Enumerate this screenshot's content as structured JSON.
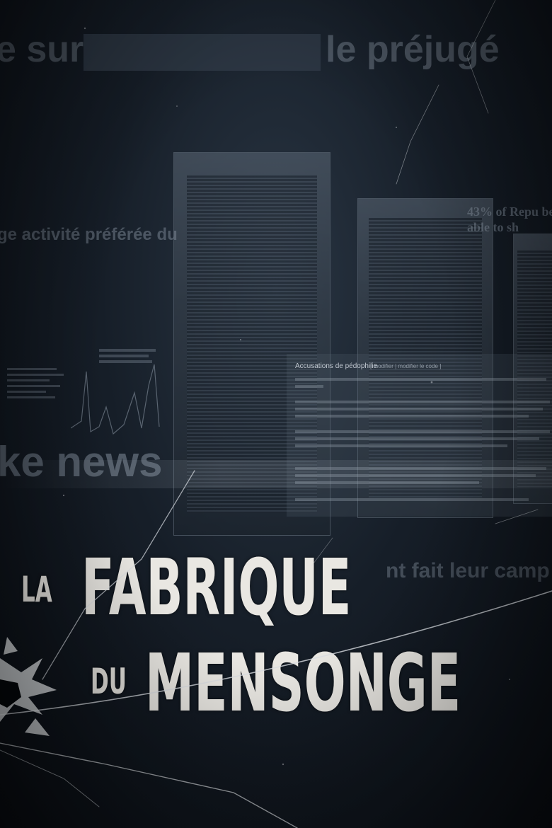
{
  "background_text": {
    "line_1_left": "e sur",
    "line_1_right": "le préjugé",
    "line_2": "ge activité préférée du",
    "line_3": "43% of Repu be able to sh",
    "line_4": "ke news",
    "line_5": "nt fait leur camp"
  },
  "document": {
    "heading": "Accusations de pédophilie",
    "edit_links": "[ modifier | modifier le code ]"
  },
  "title": {
    "article_1": "LA",
    "word_1": "FABRIQUE",
    "article_2": "DU",
    "word_2": "MENSONGE"
  },
  "colors": {
    "title": "#e9e7e2",
    "background": "#0b1016",
    "overlay_text": "#8a96a4"
  }
}
